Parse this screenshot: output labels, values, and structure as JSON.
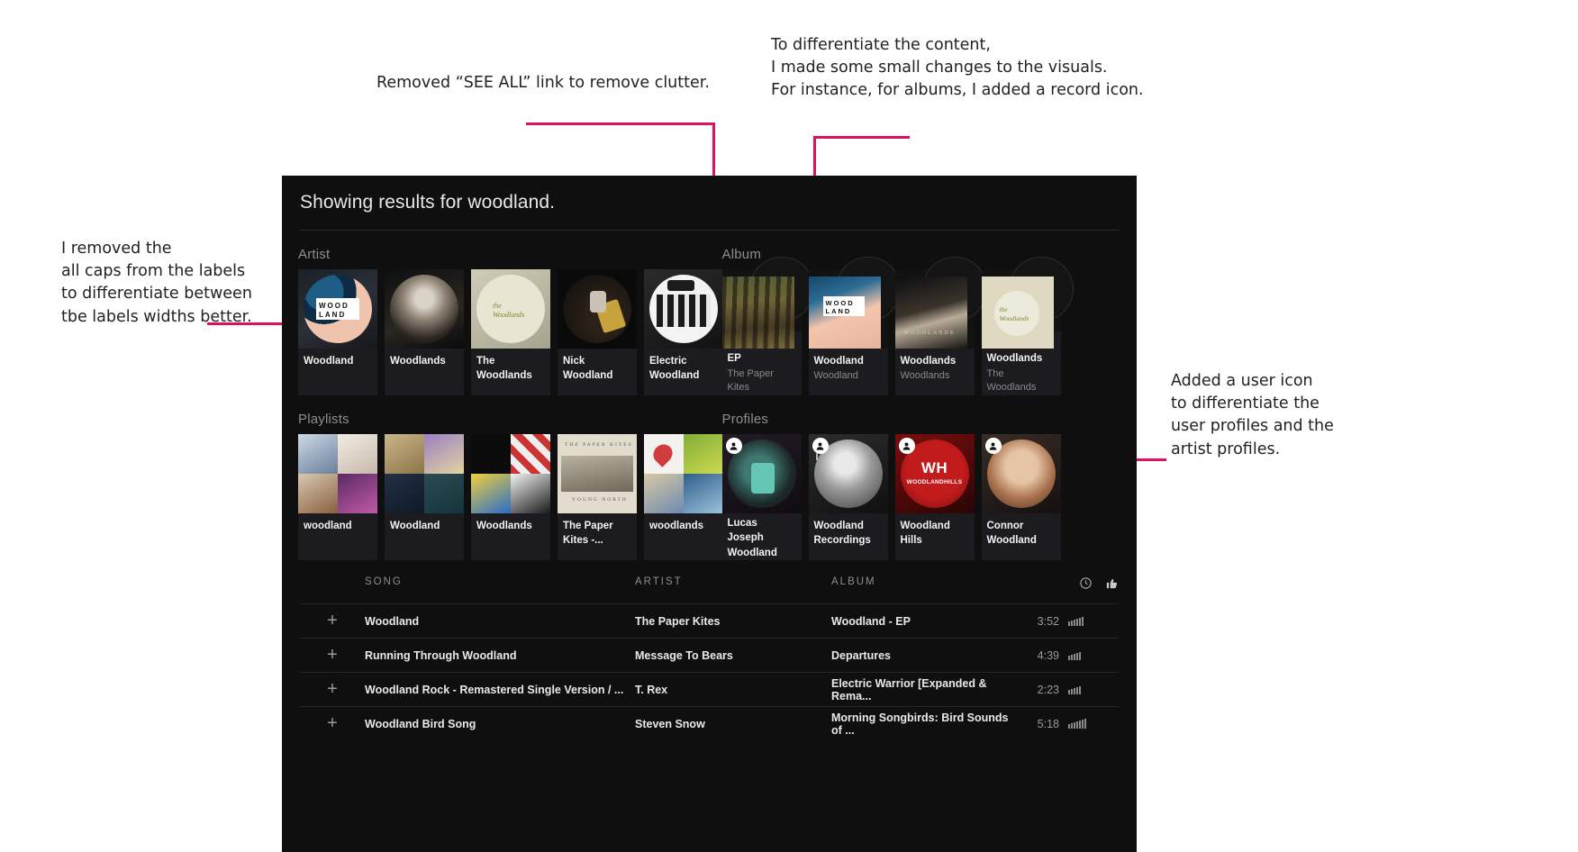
{
  "annotations": {
    "see_all": "Removed “SEE ALL” link to remove clutter.",
    "record": "To differentiate the content,\nI made some small changes to the visuals.\nFor instance, for albums, I added a record icon.",
    "labels": "I removed the\nall caps from the labels\nto differentiate between\ntbe labels widths better.",
    "user": "Added a user icon\nto differentiate the\nuser profiles and the\nartist profiles.",
    "accent_color": "#e0115f"
  },
  "app": {
    "results_title": "Showing results for woodland.",
    "sections": {
      "artist": {
        "heading": "Artist",
        "cards": [
          {
            "title": "Woodland",
            "sub": ""
          },
          {
            "title": "Woodlands",
            "sub": ""
          },
          {
            "title": "The Woodlands",
            "sub": ""
          },
          {
            "title": "Nick Woodland",
            "sub": ""
          },
          {
            "title": "Electric Woodland",
            "sub": ""
          }
        ]
      },
      "album": {
        "heading": "Album",
        "cards": [
          {
            "title": "Woodland - EP",
            "sub": "The Paper Kites"
          },
          {
            "title": "Woodland",
            "sub": "Woodland"
          },
          {
            "title": "Woodlands",
            "sub": "Woodlands"
          },
          {
            "title": "The Woodlands",
            "sub": "The Woodlands"
          }
        ]
      },
      "playlists": {
        "heading": "Playlists",
        "cards": [
          {
            "title": "woodland",
            "sub": ""
          },
          {
            "title": "Woodland",
            "sub": ""
          },
          {
            "title": "Woodlands",
            "sub": ""
          },
          {
            "title": "The Paper Kites -...",
            "sub": ""
          },
          {
            "title": "woodlands",
            "sub": ""
          }
        ]
      },
      "profiles": {
        "heading": "Profiles",
        "badge_icon": "person-icon",
        "cards": [
          {
            "title": "Lucas Joseph Woodland",
            "sub": ""
          },
          {
            "title": "Woodland Recordings",
            "sub": ""
          },
          {
            "title": "Woodland Hills",
            "sub": ""
          },
          {
            "title": "Connor Woodland",
            "sub": ""
          }
        ]
      }
    },
    "tracks": {
      "columns": {
        "song": "SONG",
        "artist": "ARTIST",
        "album": "ALBUM",
        "duration_icon": "clock-icon",
        "popularity_icon": "thumbs-up-icon"
      },
      "add_icon": "plus-icon",
      "rows": [
        {
          "song": "Woodland",
          "artist": "The Paper Kites",
          "album": "Woodland - EP",
          "duration": "3:52",
          "popularity": 6
        },
        {
          "song": "Running Through Woodland",
          "artist": "Message To Bears",
          "album": "Departures",
          "duration": "4:39",
          "popularity": 5
        },
        {
          "song": "Woodland Rock - Remastered Single Version / ...",
          "artist": "T. Rex",
          "album": "Electric Warrior [Expanded & Rema...",
          "duration": "2:23",
          "popularity": 5
        },
        {
          "song": "Woodland Bird Song",
          "artist": "Steven Snow",
          "album": "Morning Songbirds: Bird Sounds of ...",
          "duration": "5:18",
          "popularity": 7
        }
      ]
    }
  }
}
